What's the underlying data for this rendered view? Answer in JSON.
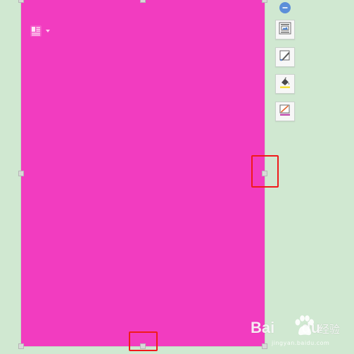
{
  "shape": {
    "fill_color": "#f23cc0"
  },
  "toolbar": {
    "collapse_icon": "minus-circle-icon",
    "buttons": [
      {
        "name": "layout-options",
        "icon": "picture-layout-icon"
      },
      {
        "name": "edit-shape",
        "icon": "pencil-edit-icon"
      },
      {
        "name": "fill",
        "icon": "paint-bucket-icon",
        "accent": "#f7e13a"
      },
      {
        "name": "outline",
        "icon": "outline-pen-icon",
        "accent": "#c24fb0"
      }
    ]
  },
  "highlight_color": "#f01a1a",
  "watermark": {
    "brand_prefix": "Bai",
    "brand_suffix": "du",
    "brand_cn": "经验",
    "url": "jingyan.baidu.com"
  }
}
